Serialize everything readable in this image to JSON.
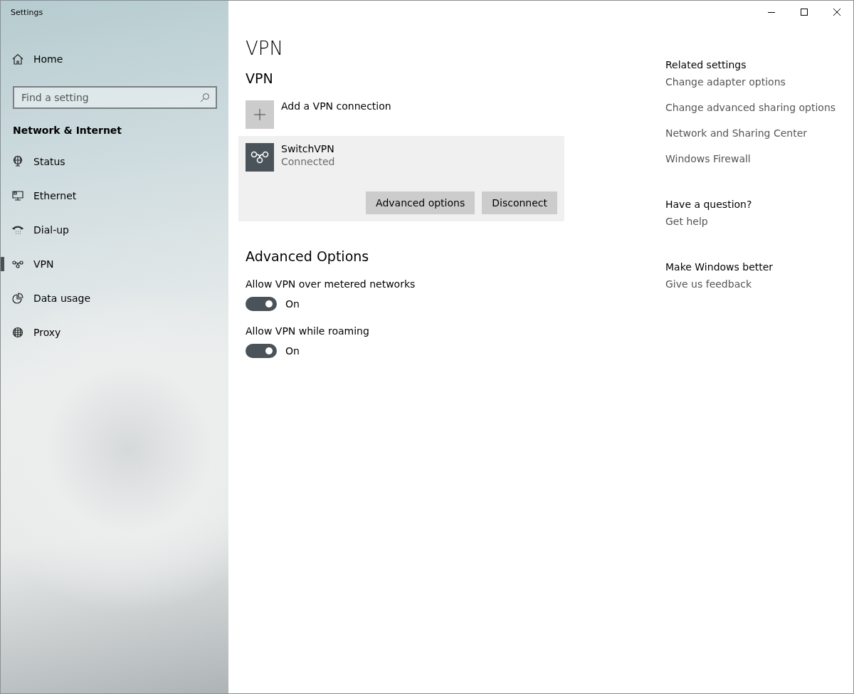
{
  "window": {
    "title": "Settings"
  },
  "sidebar": {
    "home": "Home",
    "search": {
      "placeholder": "Find a setting"
    },
    "heading": "Network & Internet",
    "items": [
      {
        "label": "Status",
        "selected": false
      },
      {
        "label": "Ethernet",
        "selected": false
      },
      {
        "label": "Dial-up",
        "selected": false
      },
      {
        "label": "VPN",
        "selected": true
      },
      {
        "label": "Data usage",
        "selected": false
      },
      {
        "label": "Proxy",
        "selected": false
      }
    ]
  },
  "main": {
    "title": "VPN",
    "section": "VPN",
    "add_label": "Add a VPN connection",
    "connection": {
      "name": "SwitchVPN",
      "status": "Connected",
      "buttons": [
        "Advanced options",
        "Disconnect"
      ]
    },
    "advanced_heading": "Advanced Options",
    "toggles": [
      {
        "label": "Allow VPN over metered networks",
        "on": true,
        "state_text": "On"
      },
      {
        "label": "Allow VPN while roaming",
        "on": true,
        "state_text": "On"
      }
    ]
  },
  "related": [
    {
      "heading": "Related settings",
      "links": [
        "Change adapter options",
        "Change advanced sharing options",
        "Network and Sharing Center",
        "Windows Firewall"
      ]
    },
    {
      "heading": "Have a question?",
      "links": [
        "Get help"
      ]
    },
    {
      "heading": "Make Windows better",
      "links": [
        "Give us feedback"
      ]
    }
  ]
}
